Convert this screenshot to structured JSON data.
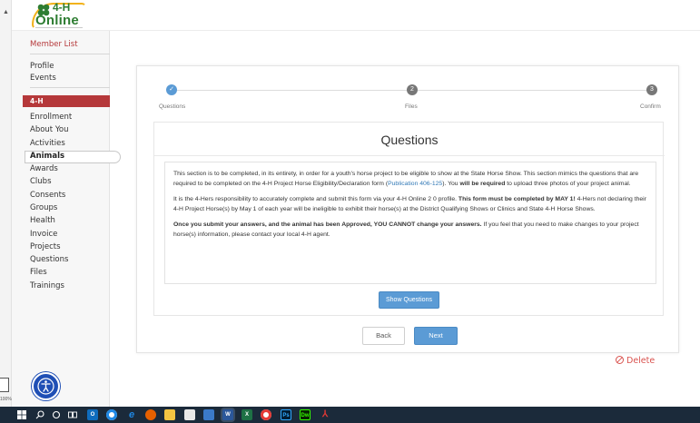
{
  "browser": {
    "zoom_text": "100%"
  },
  "logo": {
    "line1": "4-H",
    "line2": "Online"
  },
  "sidebar": {
    "member_list": "Member List",
    "top_items": [
      "Profile",
      "Events"
    ],
    "section": "4-H",
    "items": [
      "Enrollment",
      "About You",
      "Activities",
      "Animals",
      "Awards",
      "Clubs",
      "Consents",
      "Groups",
      "Health",
      "Invoice",
      "Projects",
      "Questions",
      "Files",
      "Trainings"
    ],
    "active_item": "Animals"
  },
  "steps": [
    {
      "label": "Questions",
      "marker": "✓",
      "state": "done"
    },
    {
      "label": "Files",
      "marker": "2",
      "state": "pending"
    },
    {
      "label": "Confirm",
      "marker": "3",
      "state": "pending"
    }
  ],
  "panel": {
    "title": "Questions",
    "p1_a": "This section is to be completed, in its entirety, in order for a youth's horse project to be eligible to show at the State Horse Show. This section mimics the questions that are required to be completed on the 4-H Project Horse Eligibility/Declaration form (",
    "p1_link": "Publication 406-125",
    "p1_b": "). You ",
    "p1_bold": "will be required",
    "p1_c": " to upload three photos of your project animal.",
    "p2_a": "It is the 4-Hers responsibility to accurately complete and submit this form via your 4-H Online 2 0 profile.  ",
    "p2_bold": "This form must be completed by MAY 1!",
    "p2_b": " 4-Hers not declaring their 4-H Project Horse(s) by May 1 of each year will be ineligible to exhibit their horse(s) at the District Qualifying Shows or Clinics and State 4-H Horse Shows.",
    "p3_bold": "Once you submit your answers, and the animal has been Approved, YOU CANNOT change your answers.",
    "p3_a": " If you feel that you need to make changes to your project horse(s) information, please contact your local 4-H agent.",
    "show_questions": "Show Questions"
  },
  "nav": {
    "back": "Back",
    "next": "Next"
  },
  "delete_label": "Delete",
  "taskbar": {
    "icons": [
      "windows-start",
      "search",
      "cortana",
      "task-view",
      "outlook",
      "chrome",
      "edge",
      "firefox",
      "file-explorer",
      "store",
      "photos",
      "word",
      "excel",
      "chrome-2",
      "photoshop",
      "dreamweaver",
      "acrobat"
    ],
    "labels": {
      "photoshop": "Ps",
      "dreamweaver": "Dw",
      "word": "W",
      "excel": "X"
    }
  },
  "colors": {
    "brand_red": "#b5383a",
    "accent_blue": "#5b9bd5",
    "logo_green": "#2e7d32",
    "delete_red": "#d9534f",
    "taskbar": "#1b2a3a"
  }
}
